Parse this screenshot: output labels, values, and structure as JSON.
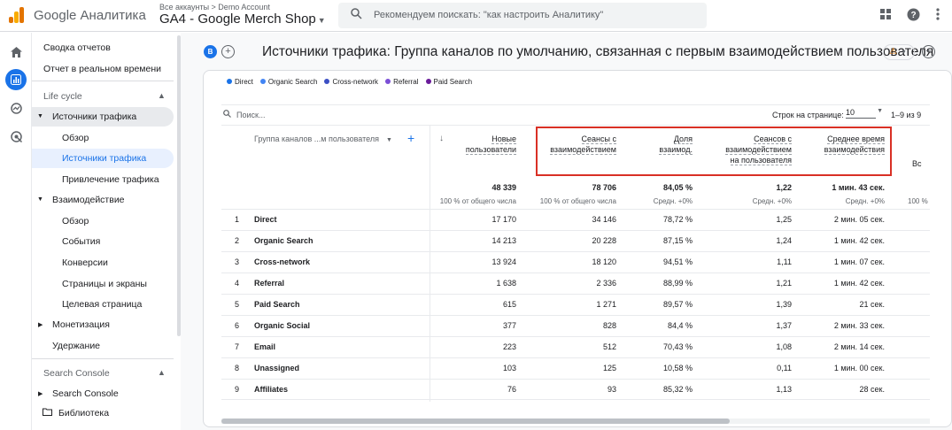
{
  "topbar": {
    "app_name": "Google Аналитика",
    "account_crumb": "Все аккаунты > Demo Account",
    "property_name": "GA4 - Google Merch Shop",
    "search_placeholder": "Рекомендуем поискать: \"как настроить Аналитику\"",
    "icons": [
      "apps-grid-icon",
      "help-icon",
      "more-vert-icon"
    ]
  },
  "rail": {
    "icons": [
      "home-icon",
      "reports-icon",
      "explore-icon",
      "advertising-icon"
    ],
    "active": "reports-icon"
  },
  "sidebar": {
    "top_items": [
      "Сводка отчетов",
      "Отчет в реальном времени"
    ],
    "lifecycle": {
      "label": "Life cycle",
      "groups": [
        {
          "label": "Источники трафика",
          "expanded": true,
          "children": [
            "Обзор",
            "Источники трафика",
            "Привлечение трафика"
          ],
          "selected_child": "Источники трафика"
        },
        {
          "label": "Взаимодействие",
          "expanded": true,
          "children": [
            "Обзор",
            "События",
            "Конверсии",
            "Страницы и экраны",
            "Целевая страница"
          ]
        },
        {
          "label": "Монетизация",
          "expanded": false
        },
        {
          "label": "Удержание",
          "expanded": false
        }
      ]
    },
    "search_console": {
      "label": "Search Console",
      "group": "Search Console"
    },
    "library": "Библиотека"
  },
  "report": {
    "compare_chip": "B",
    "title": "Источники трафика: Группа каналов по умолчанию, связанная с первым взаимодействием пользователя",
    "legend": [
      {
        "name": "Direct",
        "color": "#1a73e8"
      },
      {
        "name": "Organic Search",
        "color": "#4285f4"
      },
      {
        "name": "Cross-network",
        "color": "#3c4fc4"
      },
      {
        "name": "Referral",
        "color": "#7b4fd6"
      },
      {
        "name": "Paid Search",
        "color": "#6a1b9a"
      }
    ],
    "table": {
      "search_placeholder": "Поиск...",
      "rows_per_page_label": "Строк на странице:",
      "rows_per_page": "10",
      "page_range": "1–9 из 9",
      "dimension_header": "Группа каналов ...м пользователя",
      "metric_headers": [
        [
          "Новые",
          "пользователи"
        ],
        [
          "Сеансы с",
          "взаимодействием"
        ],
        [
          "Доля",
          "взаимод."
        ],
        [
          "Сеансов с",
          "взаимодействием",
          "на пользователя"
        ],
        [
          "Среднее время",
          "взаимодействия"
        ],
        [
          "Вс"
        ]
      ],
      "totals": [
        "48 339",
        "78 706",
        "84,05 %",
        "1,22",
        "1 мин. 43 сек."
      ],
      "totals_sub": [
        "100 % от общего числа",
        "100 % от общего числа",
        "Средн. +0%",
        "Средн. +0%",
        "Средн. +0%",
        "100 %"
      ],
      "rows": [
        {
          "i": "1",
          "name": "Direct",
          "v": [
            "17 170",
            "34 146",
            "78,72 %",
            "1,25",
            "2 мин. 05 сек."
          ]
        },
        {
          "i": "2",
          "name": "Organic Search",
          "v": [
            "14 213",
            "20 228",
            "87,15 %",
            "1,24",
            "1 мин. 42 сек."
          ]
        },
        {
          "i": "3",
          "name": "Cross-network",
          "v": [
            "13 924",
            "18 120",
            "94,51 %",
            "1,11",
            "1 мин. 07 сек."
          ]
        },
        {
          "i": "4",
          "name": "Referral",
          "v": [
            "1 638",
            "2 336",
            "88,99 %",
            "1,21",
            "1 мин. 42 сек."
          ]
        },
        {
          "i": "5",
          "name": "Paid Search",
          "v": [
            "615",
            "1 271",
            "89,57 %",
            "1,39",
            "21 сек."
          ]
        },
        {
          "i": "6",
          "name": "Organic Social",
          "v": [
            "377",
            "828",
            "84,4 %",
            "1,37",
            "2 мин. 33 сек."
          ]
        },
        {
          "i": "7",
          "name": "Email",
          "v": [
            "223",
            "512",
            "70,43 %",
            "1,08",
            "2 мин. 14 сек."
          ]
        },
        {
          "i": "8",
          "name": "Unassigned",
          "v": [
            "103",
            "125",
            "10,58 %",
            "0,11",
            "1 мин. 00 сек."
          ]
        },
        {
          "i": "9",
          "name": "Affiliates",
          "v": [
            "76",
            "93",
            "85,32 %",
            "1,13",
            "28 сек."
          ]
        }
      ]
    }
  }
}
